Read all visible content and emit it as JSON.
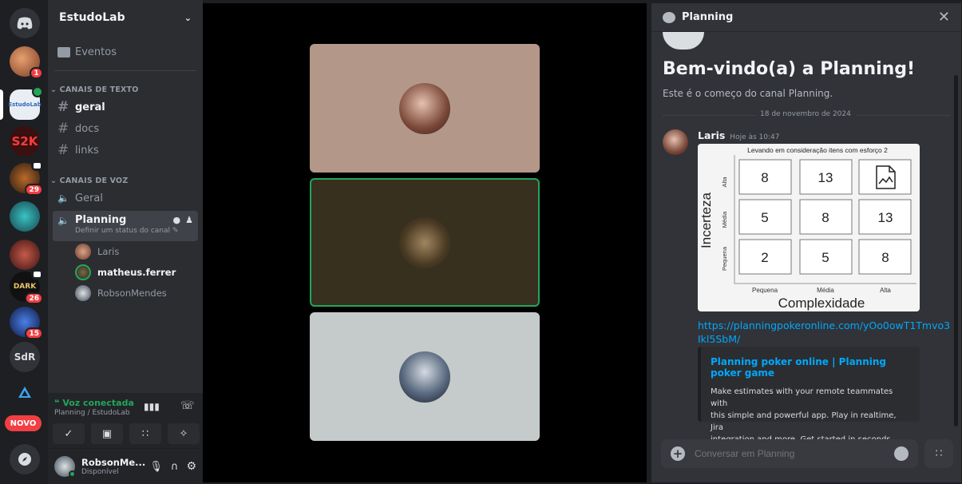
{
  "rail": {
    "servers": [
      {
        "name": "direct-messages-home",
        "badge": ""
      },
      {
        "name": "server-avatar-1",
        "badge": "1"
      },
      {
        "name": "server-estudolab",
        "badge": "",
        "label": "EstudoLab"
      },
      {
        "name": "server-s2k",
        "badge": ""
      },
      {
        "name": "server-avatar-4",
        "badge": "29"
      },
      {
        "name": "server-avatar-5",
        "badge": ""
      },
      {
        "name": "server-avatar-6",
        "badge": ""
      },
      {
        "name": "server-dark-dark",
        "badge": "26"
      },
      {
        "name": "server-avatar-8",
        "badge": "15"
      },
      {
        "name": "server-sdr",
        "label": "SdR"
      },
      {
        "name": "server-avatar-10"
      }
    ],
    "novo_label": "NOVO"
  },
  "sidebar": {
    "guild_name": "EstudoLab",
    "events_label": "Eventos",
    "text_category": "CANAIS DE TEXTO",
    "text_channels": [
      "geral",
      "docs",
      "links"
    ],
    "voice_category": "CANAIS DE VOZ",
    "voice_channels": [
      "Geral",
      "Planning"
    ],
    "planning_status": "Definir um status do canal",
    "voice_users": [
      "Laris",
      "matheus.ferrer",
      "RobsonMendes"
    ],
    "voice_connected": "Voz conectada",
    "voice_location": "Planning / EstudoLab",
    "user_name": "RobsonMe...",
    "user_status": "Disponível"
  },
  "chat": {
    "channel": "Planning",
    "welcome_title": "Bem-vindo(a) a Planning!",
    "welcome_sub": "Este é o começo do canal Planning.",
    "date_divider": "18 de novembro de 2024",
    "author": "Laris",
    "timestamp": "Hoje às 10:47",
    "link_line1": "https://planningpokeronline.com/yOo0owT1Tmvo3",
    "link_line2": "Ikl5SbM/",
    "embed_title": "Planning poker online | Planning poker game",
    "embed_desc_1": "Make estimates with your remote teammates with",
    "embed_desc_2": "this simple and powerful app. Play in realtime, Jira",
    "embed_desc_3": "integration and more. Get started in seconds.",
    "composer_placeholder": "Conversar em Planning"
  },
  "matrix_image": {
    "caption": "Levando em consideração itens com esforço 2",
    "y_title": "Incerteza",
    "x_title": "Complexidade",
    "rows": [
      "Alta",
      "Média",
      "Pequena"
    ],
    "cols": [
      "Pequena",
      "Média",
      "Alta"
    ],
    "values": [
      [
        "8",
        "13",
        ""
      ],
      [
        "5",
        "8",
        "13"
      ],
      [
        "2",
        "5",
        "8"
      ]
    ]
  },
  "colors": {
    "accent": "#5865f2",
    "link": "#00a8fc",
    "online": "#23a55a",
    "danger": "#f23f43"
  }
}
